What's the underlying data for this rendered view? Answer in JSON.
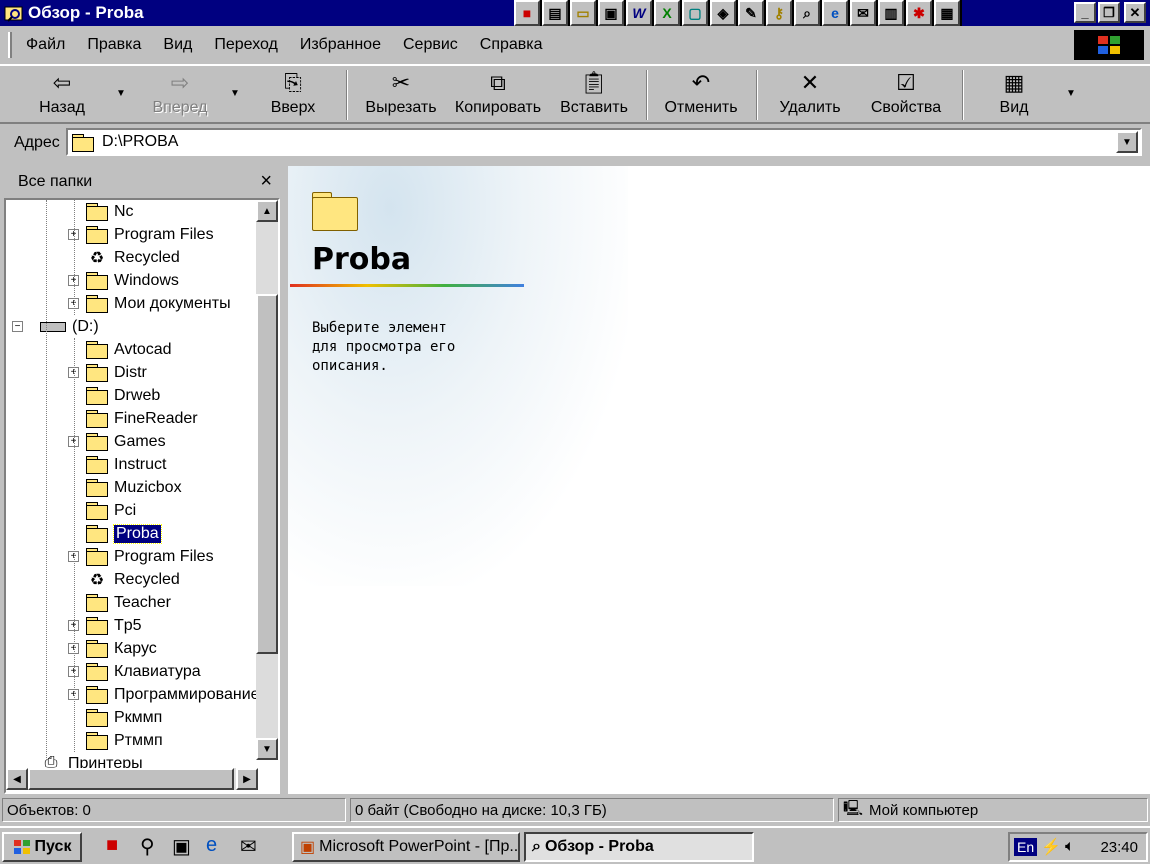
{
  "window": {
    "title": "Обзор - Proba",
    "controls": [
      "minimize",
      "maximize",
      "close"
    ]
  },
  "quick_launch_icons": [
    "office-icon",
    "notepad-icon",
    "open-folder-icon",
    "explorer-icon",
    "word-icon",
    "excel-icon",
    "display-icon",
    "network-icon",
    "paint-icon",
    "key-icon",
    "find-icon",
    "ie-icon",
    "outlook-icon",
    "screen-icon",
    "game-icon",
    "control-icon"
  ],
  "menu": {
    "items": [
      "Файл",
      "Правка",
      "Вид",
      "Переход",
      "Избранное",
      "Сервис",
      "Справка"
    ]
  },
  "toolbar": {
    "back": "Назад",
    "forward": "Вперед",
    "up": "Вверх",
    "cut": "Вырезать",
    "copy": "Копировать",
    "paste": "Вставить",
    "undo": "Отменить",
    "delete": "Удалить",
    "properties": "Свойства",
    "view": "Вид"
  },
  "address": {
    "label": "Адрес",
    "value": "D:\\PROBA"
  },
  "folder_pane": {
    "title": "Все папки",
    "close": "×",
    "items": [
      {
        "label": "Nc",
        "icon": "folder",
        "expander": ""
      },
      {
        "label": "Program Files",
        "icon": "folder",
        "expander": "+"
      },
      {
        "label": "Recycled",
        "icon": "recycle",
        "expander": ""
      },
      {
        "label": "Windows",
        "icon": "folder",
        "expander": "+"
      },
      {
        "label": "Мои документы",
        "icon": "folder-open",
        "expander": "+"
      },
      {
        "label": "(D:)",
        "icon": "drive",
        "expander": "−"
      },
      {
        "label": "Avtocad",
        "icon": "folder",
        "expander": ""
      },
      {
        "label": "Distr",
        "icon": "folder",
        "expander": "+"
      },
      {
        "label": "Drweb",
        "icon": "folder",
        "expander": ""
      },
      {
        "label": "FineReader",
        "icon": "folder",
        "expander": ""
      },
      {
        "label": "Games",
        "icon": "folder",
        "expander": "+"
      },
      {
        "label": "Instruct",
        "icon": "folder",
        "expander": ""
      },
      {
        "label": "Muzicbox",
        "icon": "folder",
        "expander": ""
      },
      {
        "label": "Pci",
        "icon": "folder",
        "expander": ""
      },
      {
        "label": "Proba",
        "icon": "folder-open",
        "expander": "",
        "selected": true
      },
      {
        "label": "Program Files",
        "icon": "folder",
        "expander": "+"
      },
      {
        "label": "Recycled",
        "icon": "recycle",
        "expander": ""
      },
      {
        "label": "Teacher",
        "icon": "folder",
        "expander": ""
      },
      {
        "label": "Tp5",
        "icon": "folder",
        "expander": "+"
      },
      {
        "label": "Карус",
        "icon": "folder",
        "expander": "+"
      },
      {
        "label": "Клавиатура",
        "icon": "folder",
        "expander": "+"
      },
      {
        "label": "Программирование",
        "icon": "folder",
        "expander": "+"
      },
      {
        "label": "Ркммп",
        "icon": "folder",
        "expander": ""
      },
      {
        "label": "Ртммп",
        "icon": "folder",
        "expander": ""
      },
      {
        "label": "Принтеры",
        "icon": "printer",
        "expander": ""
      }
    ]
  },
  "content": {
    "title": "Proba",
    "description": "Выберите элемент\nдля просмотра его\nописания."
  },
  "status": {
    "objects": "Объектов: 0",
    "size": "0 байт (Свободно на диске: 10,3 ГБ)",
    "location": "Мой компьютер"
  },
  "taskbar": {
    "start": "Пуск",
    "tasks": [
      "Microsoft PowerPoint - [Пр...",
      "Обзор - Proba"
    ],
    "lang": "En",
    "clock": "23:40"
  },
  "colors": {
    "titlebar": "#000080",
    "face": "#c0c0c0",
    "selection": "#000080"
  }
}
